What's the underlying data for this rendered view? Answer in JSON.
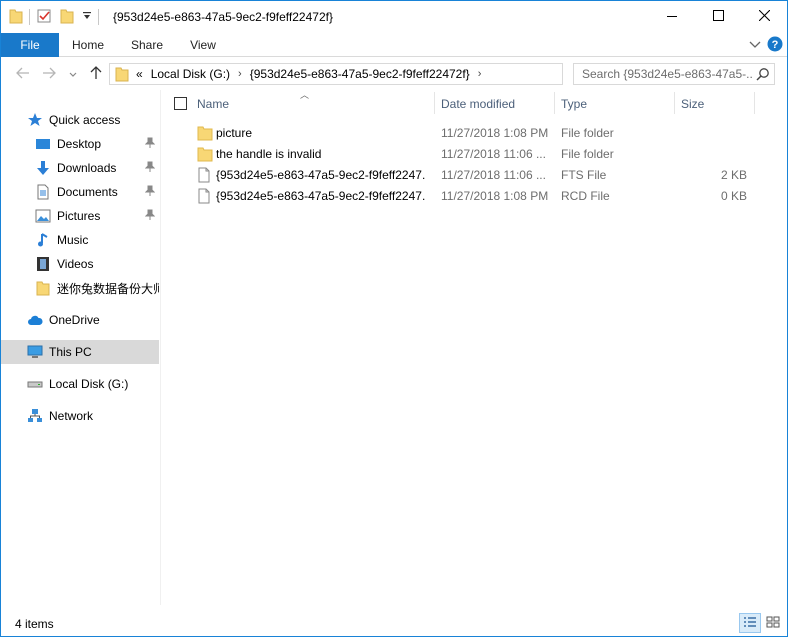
{
  "window": {
    "title": "{953d24e5-e863-47a5-9ec2-f9feff22472f}"
  },
  "ribbon": {
    "tabs": [
      {
        "label": "File"
      },
      {
        "label": "Home"
      },
      {
        "label": "Share"
      },
      {
        "label": "View"
      }
    ]
  },
  "address": {
    "overflow": "«",
    "crumbs": [
      "Local Disk (G:)",
      "{953d24e5-e863-47a5-9ec2-f9feff22472f}"
    ],
    "search_placeholder": "Search {953d24e5-e863-47a5-..."
  },
  "nav": {
    "items": [
      {
        "label": "Quick access",
        "icon": "star-icon"
      },
      {
        "label": "Desktop",
        "icon": "desktop-icon",
        "pinned": true
      },
      {
        "label": "Downloads",
        "icon": "download-arrow-icon",
        "pinned": true
      },
      {
        "label": "Documents",
        "icon": "documents-icon",
        "pinned": true
      },
      {
        "label": "Pictures",
        "icon": "pictures-icon",
        "pinned": true
      },
      {
        "label": "Music",
        "icon": "music-note-icon"
      },
      {
        "label": "Videos",
        "icon": "film-icon"
      },
      {
        "label": "迷你兔数据备份大师",
        "icon": "folder-icon"
      },
      {
        "label": "OneDrive",
        "icon": "cloud-icon"
      },
      {
        "label": "This PC",
        "icon": "computer-icon",
        "selected": true
      },
      {
        "label": "Local Disk (G:)",
        "icon": "drive-icon"
      },
      {
        "label": "Network",
        "icon": "network-icon"
      }
    ]
  },
  "columns": {
    "name": "Name",
    "date": "Date modified",
    "type": "Type",
    "size": "Size"
  },
  "files": [
    {
      "name": "picture",
      "date": "11/27/2018 1:08 PM",
      "type": "File folder",
      "size": "",
      "icon": "folder-icon"
    },
    {
      "name": "the handle is invalid",
      "date": "11/27/2018 11:06 ...",
      "type": "File folder",
      "size": "",
      "icon": "folder-icon"
    },
    {
      "name": "{953d24e5-e863-47a5-9ec2-f9feff2247...",
      "date": "11/27/2018 11:06 ...",
      "type": "FTS File",
      "size": "2 KB",
      "icon": "file-icon"
    },
    {
      "name": "{953d24e5-e863-47a5-9ec2-f9feff2247...",
      "date": "11/27/2018 1:08 PM",
      "type": "RCD File",
      "size": "0 KB",
      "icon": "file-icon"
    }
  ],
  "status": {
    "item_count": "4 items"
  },
  "colors": {
    "accent": "#1979ca",
    "folder": "#f8d775",
    "selected_nav": "#d9d9d9",
    "header_text": "#4c607a"
  }
}
